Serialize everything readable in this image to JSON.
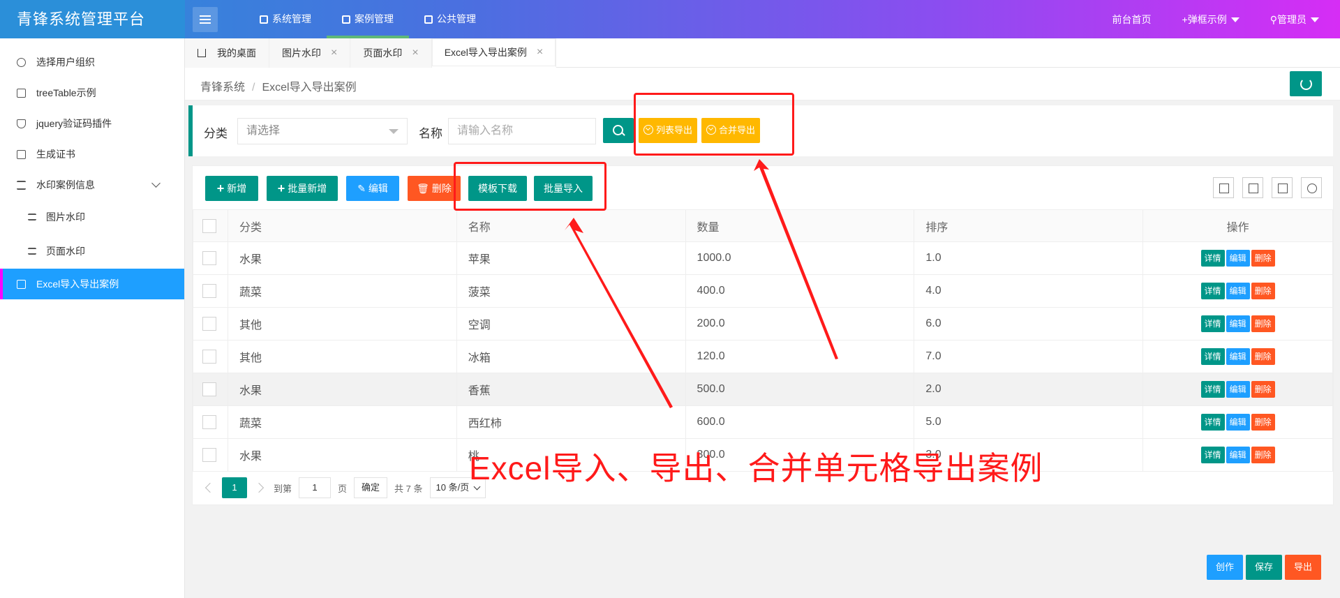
{
  "app": {
    "title": "青锋系统管理平台"
  },
  "topnav": [
    {
      "label": "系统管理",
      "active": false
    },
    {
      "label": "案例管理",
      "active": true
    },
    {
      "label": "公共管理",
      "active": false
    }
  ],
  "topright": {
    "home": "前台首页",
    "popup": "+弹框示例",
    "user": "管理员"
  },
  "sidebar": {
    "items": [
      {
        "label": "选择用户组织"
      },
      {
        "label": "treeTable示例"
      },
      {
        "label": "jquery验证码插件"
      },
      {
        "label": "生成证书"
      },
      {
        "label": "水印案例信息"
      },
      {
        "label": "图片水印"
      },
      {
        "label": "页面水印"
      },
      {
        "label": "Excel导入导出案例"
      }
    ]
  },
  "tabs": [
    {
      "label": "我的桌面"
    },
    {
      "label": "图片水印"
    },
    {
      "label": "页面水印"
    },
    {
      "label": "Excel导入导出案例"
    }
  ],
  "breadcrumb": {
    "root": "青锋系统",
    "sep": "/",
    "current": "Excel导入导出案例"
  },
  "search": {
    "category_label": "分类",
    "category_value": "请选择",
    "name_label": "名称",
    "name_placeholder": "请输入名称",
    "export_list": "列表导出",
    "export_merge": "合并导出"
  },
  "toolbar": {
    "add": "新增",
    "batch_add": "批量新增",
    "edit": "编辑",
    "delete": "删除",
    "template_download": "模板下载",
    "batch_import": "批量导入"
  },
  "table": {
    "columns": [
      "分类",
      "名称",
      "数量",
      "排序",
      "操作"
    ],
    "rows": [
      {
        "category": "水果",
        "name": "苹果",
        "qty": "1000.0",
        "order": "1.0"
      },
      {
        "category": "蔬菜",
        "name": "菠菜",
        "qty": "400.0",
        "order": "4.0"
      },
      {
        "category": "其他",
        "name": "空调",
        "qty": "200.0",
        "order": "6.0"
      },
      {
        "category": "其他",
        "name": "冰箱",
        "qty": "120.0",
        "order": "7.0"
      },
      {
        "category": "水果",
        "name": "香蕉",
        "qty": "500.0",
        "order": "2.0"
      },
      {
        "category": "蔬菜",
        "name": "西红柿",
        "qty": "600.0",
        "order": "5.0"
      },
      {
        "category": "水果",
        "name": "桃",
        "qty": "300.0",
        "order": "3.0"
      }
    ],
    "row_actions": {
      "detail": "详情",
      "edit": "编辑",
      "delete": "删除"
    }
  },
  "pagination": {
    "current": "1",
    "goto_label": "到第",
    "goto_value": "1",
    "page_unit": "页",
    "confirm": "确定",
    "total": "共 7 条",
    "page_size": "10 条/页"
  },
  "annotation": {
    "text": "Excel导入、导出、合并单元格导出案例",
    "color": "#ff1a1a"
  },
  "bottom_buttons": {
    "create": "创作",
    "save": "保存",
    "export": "导出"
  },
  "colors": {
    "primary": "#009688",
    "blue": "#1e9fff",
    "orange": "#ff5722",
    "yellow": "#ffb800"
  }
}
